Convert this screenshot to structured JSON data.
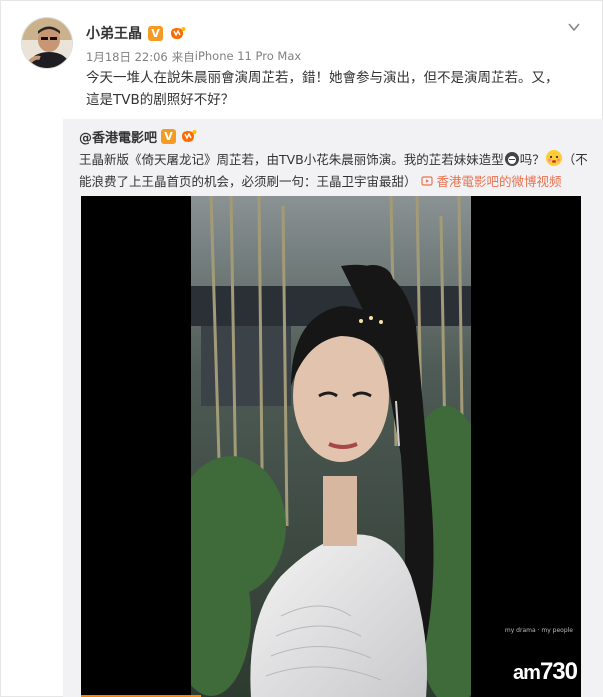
{
  "post": {
    "username": "小弟王晶",
    "verified_badge": "V",
    "date": "1月18日 22:06",
    "source_prefix": "来自",
    "source": "iPhone 11 Pro Max",
    "text_line1": "今天一堆人在說朱晨丽會演周芷若，錯！她會参与演出，但不是演周芷若。又，",
    "text_line2": "這是TVB的剧照好不好？"
  },
  "repost": {
    "username": "@香港電影吧",
    "verified_badge": "V",
    "line1_a": "王晶新版《倚天屠龙记》周芷若，由TVB小花朱晨丽饰演。我的芷若妹妹造型",
    "line1_b": "吗？",
    "line1_c": "（不",
    "line2_a": "能浪费了上王晶首页的机会，必须刷一句：王晶卫宇宙最甜）",
    "video_link": "香港電影吧的微博视频"
  },
  "video": {
    "watermark_am": "am",
    "watermark_num": "730",
    "tiny_caption": "my drama · my people"
  },
  "icons": [
    "avatar",
    "verified-icon",
    "level-icon",
    "chevron-down-icon",
    "emoji-icon",
    "video-link-icon"
  ],
  "colors": {
    "link": "#eb7350",
    "badge": "#f59a23",
    "repost_bg": "#f2f2f5",
    "text": "#333333",
    "meta": "#808080"
  }
}
